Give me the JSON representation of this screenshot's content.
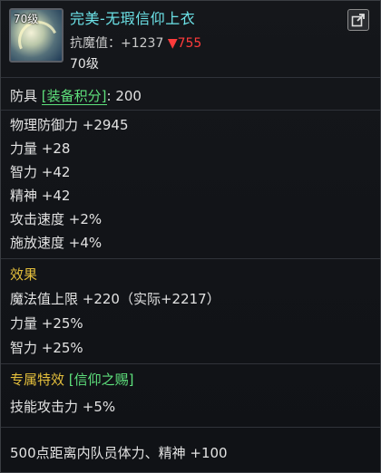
{
  "header": {
    "icon_level": "70级",
    "item_name": "完美-无瑕信仰上衣",
    "resist_label": "抗魔值：",
    "resist_plus": "+1237",
    "resist_down": "▼755",
    "level_req": "70级"
  },
  "armor": {
    "type_label": "防具",
    "score_label": "[装备积分]",
    "score_value": ": 200"
  },
  "base_stats": [
    "物理防御力 +2945",
    "力量 +28",
    "智力 +42",
    "精神 +42",
    "攻击速度 +2%",
    "施放速度 +4%"
  ],
  "effect": {
    "title": "效果",
    "lines": [
      "魔法值上限 +220（实际+2217）",
      "力量 +25%",
      "智力 +25%"
    ]
  },
  "special": {
    "title": "专属特效",
    "name": "[信仰之赐]",
    "lines": [
      "技能攻击力 +5%"
    ]
  },
  "footer": {
    "text": "500点距离内队员体力、精神 +100"
  },
  "colors": {
    "item_name": "#6ce3e8",
    "section_title": "#e4bf3c",
    "accent": "#5ee07c",
    "resist_down": "#ff3b3b"
  }
}
